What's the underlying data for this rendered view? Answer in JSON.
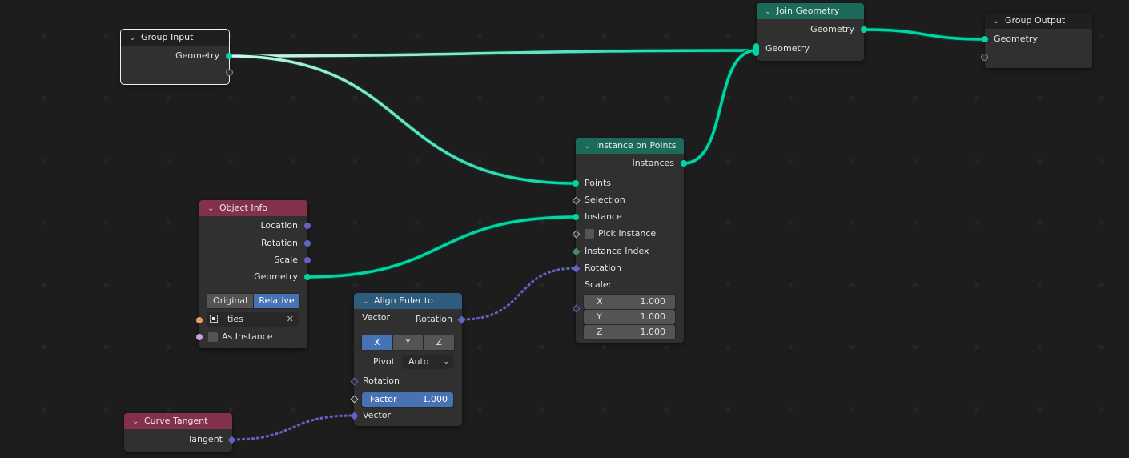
{
  "editor": {
    "type": "Geometry Node Editor",
    "background": "#1d1d1d"
  },
  "colors": {
    "geometry_socket": "#00d6a3",
    "vector_socket": "#6363c7",
    "field_socket": "#c8a2d6",
    "int_socket": "#4f8a5a",
    "object_socket": "#ed9e5c",
    "geometry_header": "#1c6b5a",
    "input_header": "#83314a",
    "vector_header": "#2d5c7c",
    "active_button": "#4772b3"
  },
  "nodes": {
    "group_input": {
      "title": "Group Input",
      "outputs": [
        "Geometry"
      ]
    },
    "join_geometry": {
      "title": "Join Geometry",
      "outputs": [
        "Geometry"
      ],
      "inputs": [
        "Geometry"
      ]
    },
    "group_output": {
      "title": "Group Output",
      "inputs": [
        "Geometry"
      ]
    },
    "instance_on_points": {
      "title": "Instance on Points",
      "outputs": [
        "Instances"
      ],
      "inputs": [
        "Points",
        "Selection",
        "Instance",
        "Pick Instance",
        "Instance Index",
        "Rotation"
      ],
      "scale_label": "Scale:",
      "scale": [
        {
          "axis": "X",
          "value": "1.000"
        },
        {
          "axis": "Y",
          "value": "1.000"
        },
        {
          "axis": "Z",
          "value": "1.000"
        }
      ]
    },
    "object_info": {
      "title": "Object Info",
      "outputs": [
        "Location",
        "Rotation",
        "Scale",
        "Geometry"
      ],
      "transform_space": [
        "Original",
        "Relative"
      ],
      "transform_space_active": "Relative",
      "object_field": "ties",
      "as_instance_label": "As Instance"
    },
    "align_euler": {
      "title": "Align Euler to Vector",
      "outputs": [
        "Rotation"
      ],
      "axis": [
        "X",
        "Y",
        "Z"
      ],
      "axis_active": "X",
      "pivot_label": "Pivot",
      "pivot_value": "Auto",
      "inputs": [
        "Rotation",
        "Vector"
      ],
      "factor_label": "Factor",
      "factor_value": "1.000"
    },
    "curve_tangent": {
      "title": "Curve Tangent",
      "outputs": [
        "Tangent"
      ]
    }
  }
}
